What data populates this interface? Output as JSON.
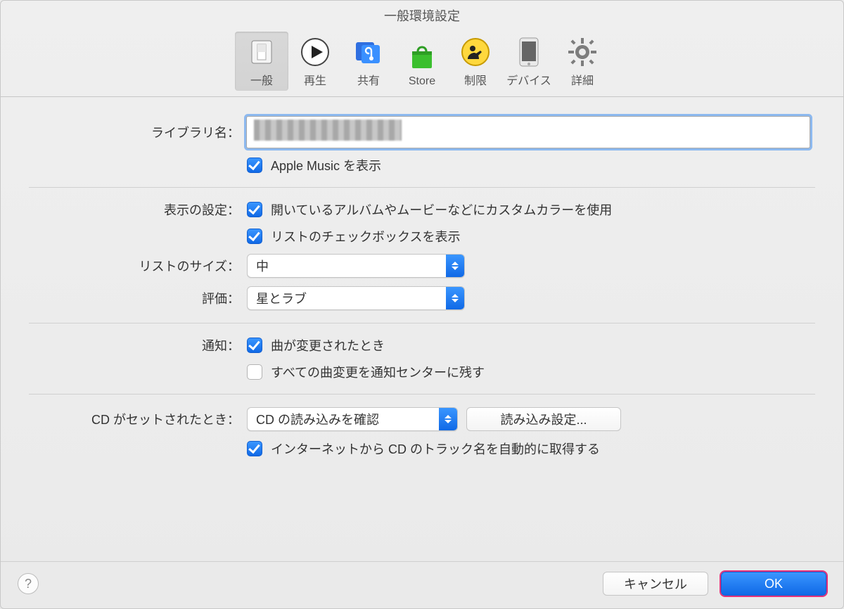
{
  "window": {
    "title": "一般環境設定"
  },
  "tabs": {
    "general": "一般",
    "playback": "再生",
    "sharing": "共有",
    "store": "Store",
    "restrictions": "制限",
    "devices": "デバイス",
    "advanced": "詳細"
  },
  "labels": {
    "library_name": "ライブラリ名：",
    "view_settings": "表示の設定：",
    "list_size": "リストのサイズ：",
    "rating": "評価：",
    "notifications": "通知：",
    "cd_insert": "CD がセットされたとき："
  },
  "fields": {
    "apple_music": "Apple Music を表示",
    "custom_color": "開いているアルバムやムービーなどにカスタムカラーを使用",
    "list_checkboxes": "リストのチェックボックスを表示",
    "list_size_value": "中",
    "rating_value": "星とラブ",
    "song_changed": "曲が変更されたとき",
    "keep_in_nc": "すべての曲変更を通知センターに残す",
    "cd_action_value": "CD の読み込みを確認",
    "import_settings": "読み込み設定...",
    "auto_track_names": "インターネットから CD のトラック名を自動的に取得する"
  },
  "buttons": {
    "cancel": "キャンセル",
    "ok": "OK",
    "help": "?"
  }
}
